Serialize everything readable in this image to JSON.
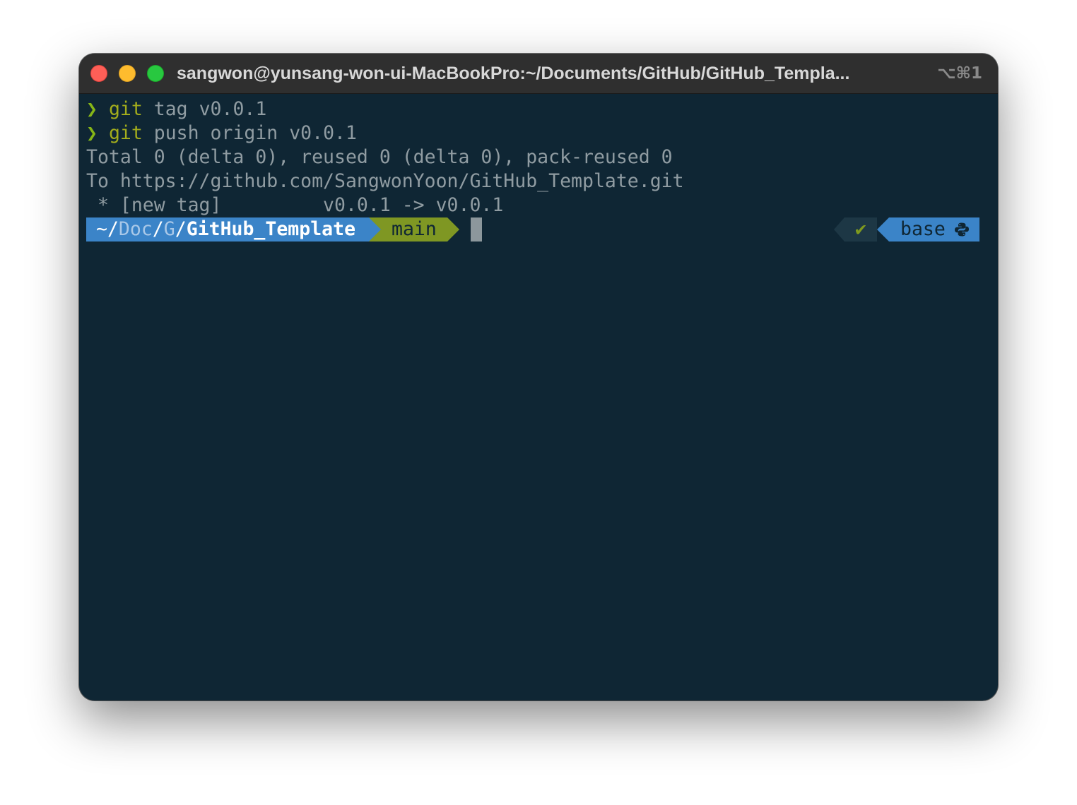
{
  "window": {
    "title": "sangwon@yunsang-won-ui-MacBookPro:~/Documents/GitHub/GitHub_Templa...",
    "shortcut": "⌥⌘1",
    "traffic_lights": {
      "close": "#fe5f57",
      "minimize": "#febc2e",
      "maximize": "#28c840"
    }
  },
  "terminal": {
    "background": "#0f2634",
    "history": [
      {
        "prompt": "❯",
        "command": "git",
        "args": " tag v0.0.1"
      },
      {
        "prompt": "❯",
        "command": "git",
        "args": " push origin v0.0.1"
      }
    ],
    "output": [
      "Total 0 (delta 0), reused 0 (delta 0), pack-reused 0",
      "To https://github.com/SangwonYoon/GitHub_Template.git",
      " * [new tag]         v0.0.1 -> v0.0.1"
    ],
    "prompt_line": {
      "path_home": "~/",
      "path_dim_1": "Doc",
      "path_sep_1": "/",
      "path_dim_2": "G",
      "path_sep_2": "/",
      "path_current": "GitHub_Template",
      "branch": "main",
      "status_icon": "✔",
      "env_name": "base",
      "env_icon": "python-icon",
      "path_color": "#3b84c8",
      "branch_color": "#7f9723"
    }
  }
}
